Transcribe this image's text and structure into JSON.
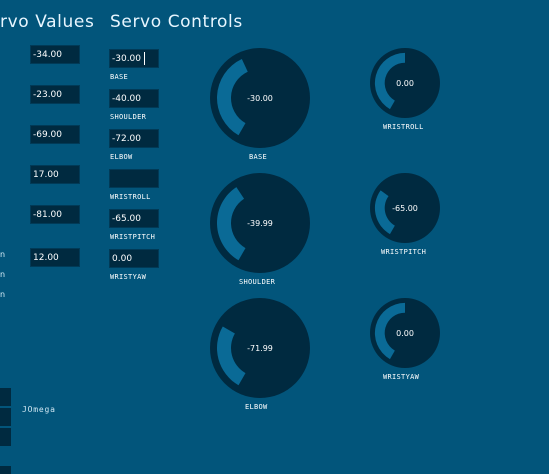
{
  "headings": {
    "servo_values": "rvo Values",
    "servo_controls": "Servo Controls"
  },
  "servo_values": [
    "-34.00",
    "-23.00",
    "-69.00",
    "17.00",
    "-81.00",
    "12.00"
  ],
  "servo_controls": [
    {
      "name": "BASE",
      "value": "-30.00"
    },
    {
      "name": "SHOULDER",
      "value": "-40.00"
    },
    {
      "name": "ELBOW",
      "value": "-72.00"
    },
    {
      "name": "WRISTROLL",
      "value": ""
    },
    {
      "name": "WRISTPITCH",
      "value": "-65.00"
    },
    {
      "name": "WRISTYAW",
      "value": "0.00"
    }
  ],
  "knobs": {
    "base": {
      "label": "BASE",
      "display": "-30.00",
      "value": -30
    },
    "shoulder": {
      "label": "SHOULDER",
      "display": "-39.99",
      "value": -39.99
    },
    "elbow": {
      "label": "ELBOW",
      "display": "-71.99",
      "value": -71.99
    },
    "wristroll": {
      "label": "WRISTROLL",
      "display": "0.00",
      "value": 0
    },
    "wristpitch": {
      "label": "WRISTPITCH",
      "display": "-65.00",
      "value": -65
    },
    "wristyaw": {
      "label": "WRISTYAW",
      "display": "0.00",
      "value": 0
    }
  },
  "side_labels": [
    "n",
    "n",
    "n"
  ],
  "jomega_label": "JOmega",
  "colors": {
    "background": "#02557b",
    "field": "#002a40",
    "knob": "#002a40",
    "arc": "#0a6a96"
  }
}
